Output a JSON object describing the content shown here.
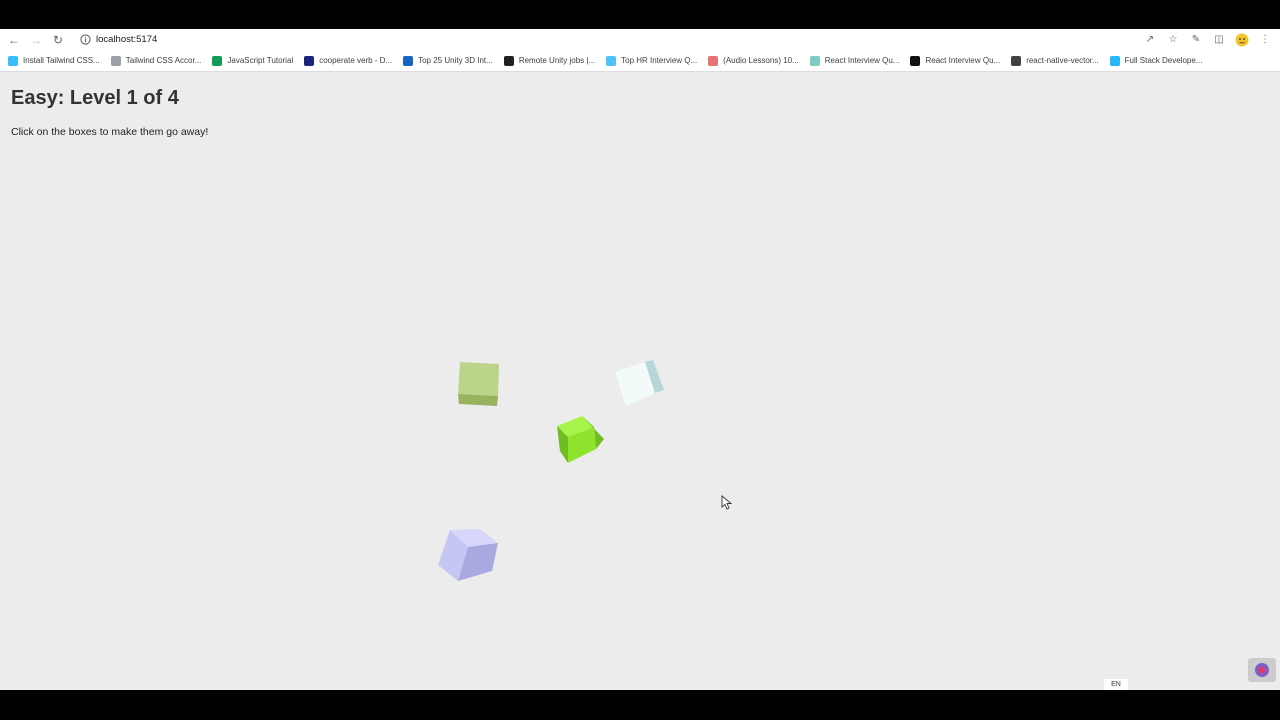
{
  "browser": {
    "url": "localhost:5174",
    "bookmarks": [
      {
        "label": "Install Tailwind CSS...",
        "color": "#38bdf8"
      },
      {
        "label": "Tailwind CSS Accor...",
        "color": "#9aa0a6"
      },
      {
        "label": "JavaScript Tutorial",
        "color": "#0f9d58"
      },
      {
        "label": "cooperate verb - D...",
        "color": "#1a237e"
      },
      {
        "label": "Top 25 Unity 3D Int...",
        "color": "#1565c0"
      },
      {
        "label": "Remote Unity jobs |...",
        "color": "#212121"
      },
      {
        "label": "Top HR Interview Q...",
        "color": "#4fc3f7"
      },
      {
        "label": "(Audio Lessons) 10...",
        "color": "#e57373"
      },
      {
        "label": "React Interview Qu...",
        "color": "#80cbc4"
      },
      {
        "label": "React Interview Qu...",
        "color": "#111111"
      },
      {
        "label": "react-native-vector...",
        "color": "#424242"
      },
      {
        "label": "Full Stack Develope...",
        "color": "#29b6f6"
      }
    ]
  },
  "game": {
    "title": "Easy: Level 1 of 4",
    "instructions": "Click on the boxes to make them go away!",
    "cubes": [
      {
        "name": "olive",
        "top": "#bcd38a",
        "left": "#aac371",
        "right": "#99b25f"
      },
      {
        "name": "ice",
        "top": "#f2fafa",
        "left": "#e6f5f6",
        "right": "#b7d6d9"
      },
      {
        "name": "lime",
        "top": "#a8f44a",
        "left": "#8fe32c",
        "right": "#6fbd21"
      },
      {
        "name": "lavender",
        "top": "#d7d7fb",
        "left": "#c6c6f4",
        "right": "#a9a9e0"
      }
    ]
  },
  "taskbar": {
    "language": "EN"
  }
}
